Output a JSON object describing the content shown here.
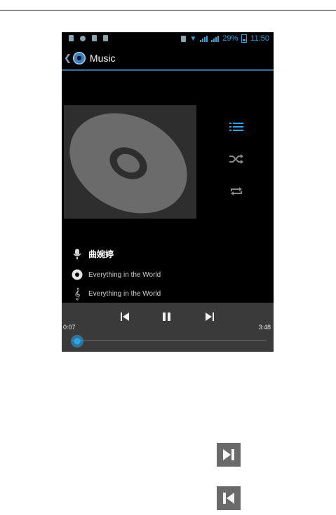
{
  "status_bar": {
    "battery": "29%",
    "time": "11:50"
  },
  "action_bar": {
    "title": "Music"
  },
  "track_info": {
    "artist": "曲婉婷",
    "album": "Everything in the World",
    "song": "Everything in the World"
  },
  "playback": {
    "elapsed": "0:07",
    "duration": "3:48",
    "progress_fraction": 0.03
  },
  "colors": {
    "accent": "#2aa7e8",
    "panel": "#3a3a3a",
    "album_bg": "#2e2e2e"
  },
  "icons": {
    "side": [
      "playlist-icon",
      "shuffle-icon",
      "repeat-icon"
    ],
    "legend": [
      "next-icon",
      "previous-icon"
    ]
  }
}
